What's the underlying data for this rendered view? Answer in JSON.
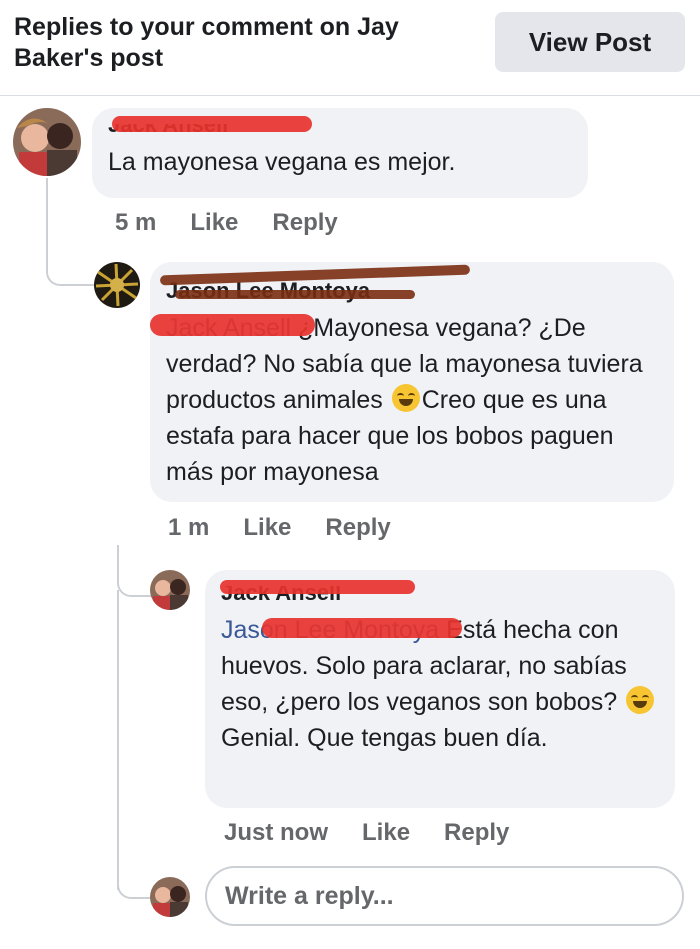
{
  "header": {
    "title": "Replies to your comment on Jay Baker's post",
    "view_post_label": "View Post"
  },
  "comments": [
    {
      "author": "Jack Ansell",
      "text": "La mayonesa vegana es mejor.",
      "time": "5 m",
      "like_label": "Like",
      "reply_label": "Reply"
    },
    {
      "author": "Jason Lee Montoya",
      "mention": "Jack Ansell",
      "text_1": " ¿Mayonesa vegana? ¿De verdad? No sabía que la mayonesa tuviera productos animales ",
      "text_2": "Creo que es una estafa para hacer que los bobos paguen más por mayonesa",
      "emoji": "rolling-on-floor-laughing-emoji",
      "time": "1 m",
      "like_label": "Like",
      "reply_label": "Reply"
    },
    {
      "author": "Jack Ansell",
      "mention": "Jason Lee Montoya",
      "text_1": " Está hecha con huevos. Solo para aclarar, no sabías eso, ¿pero los veganos son bobos? ",
      "text_2": "Genial. Que tengas buen día.",
      "emoji": "tears-of-joy-emoji",
      "time": "Just now",
      "like_label": "Like",
      "reply_label": "Reply"
    }
  ],
  "reply_box": {
    "placeholder": "Write a reply..."
  }
}
